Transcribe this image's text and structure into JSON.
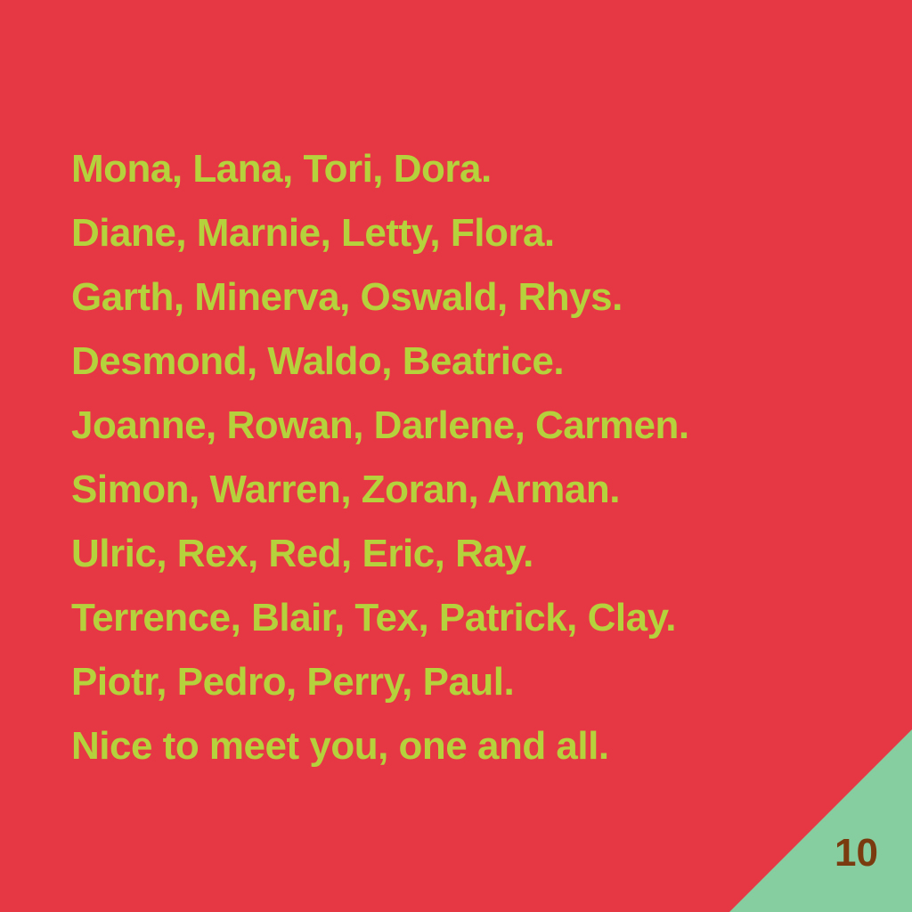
{
  "verse": {
    "lines": [
      "Mona, Lana, Tori, Dora.",
      "Diane, Marnie, Letty, Flora.",
      "Garth, Minerva, Oswald, Rhys.",
      "Desmond, Waldo, Beatrice.",
      "Joanne, Rowan, Darlene, Carmen.",
      "Simon, Warren, Zoran, Arman.",
      "Ulric, Rex, Red, Eric, Ray.",
      "Terrence, Blair, Tex, Patrick, Clay.",
      "Piotr, Pedro, Perry, Paul.",
      "Nice to meet you, one and all."
    ]
  },
  "page_number": "10",
  "colors": {
    "background": "#e63844",
    "text": "#b5d23c",
    "corner": "#86cda0",
    "page_number": "#7a3b0f"
  }
}
